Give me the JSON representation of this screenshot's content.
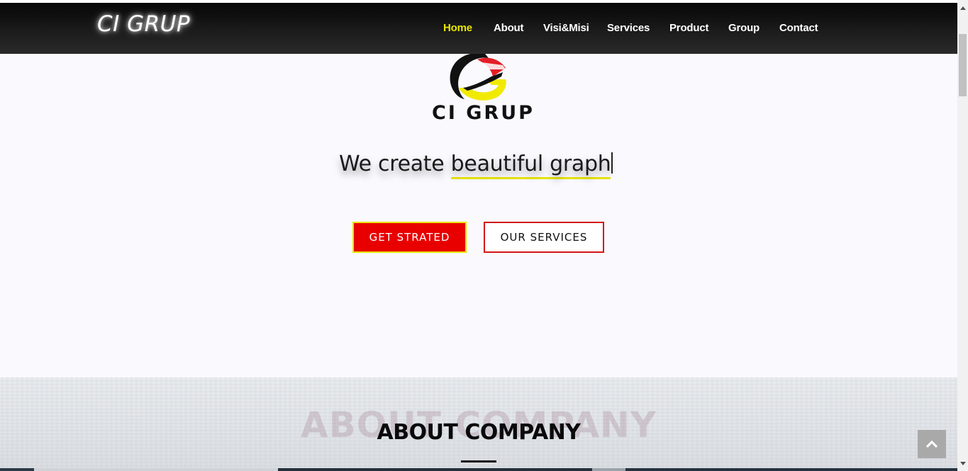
{
  "navbar": {
    "brand": "CI GRUP",
    "items": [
      {
        "label": "Home",
        "active": true
      },
      {
        "label": "About",
        "active": false
      },
      {
        "label": "Visi&Misi",
        "active": false
      },
      {
        "label": "Services",
        "active": false
      },
      {
        "label": "Product",
        "active": false
      },
      {
        "label": "Group",
        "active": false
      },
      {
        "label": "Contact",
        "active": false
      }
    ]
  },
  "hero": {
    "logo_text": "CI GRUP",
    "tagline_prefix": "We create ",
    "tagline_typed": "beautiful graph",
    "primary_button": "GET STRATED",
    "secondary_button": "OUR SERVICES"
  },
  "about": {
    "ghost_title": "ABOUT COMPANY",
    "title": "ABOUT COMPANY"
  },
  "colors": {
    "active_nav": "#e8e600",
    "primary_button": "#e80000",
    "accent_yellow": "#e9e50a",
    "outline_red": "#d31616"
  },
  "icons": {
    "scroll_top": "chevron-up-icon"
  }
}
